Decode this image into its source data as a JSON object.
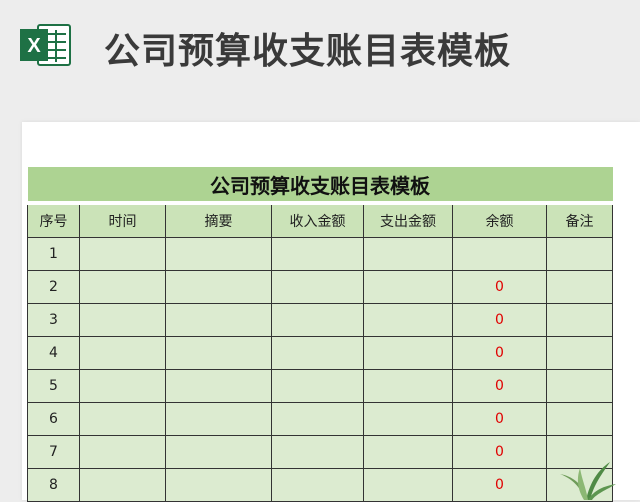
{
  "header": {
    "title": "公司预算收支账目表模板",
    "icon": "excel-icon",
    "icon_letter": "X"
  },
  "sheet": {
    "title": "公司预算收支账目表模板",
    "columns": [
      "序号",
      "时间",
      "摘要",
      "收入金额",
      "支出金额",
      "余额",
      "备注"
    ],
    "rows": [
      {
        "index": "1",
        "time": "",
        "summary": "",
        "income": "",
        "expense": "",
        "balance": "",
        "note": ""
      },
      {
        "index": "2",
        "time": "",
        "summary": "",
        "income": "",
        "expense": "",
        "balance": "0",
        "note": ""
      },
      {
        "index": "3",
        "time": "",
        "summary": "",
        "income": "",
        "expense": "",
        "balance": "0",
        "note": ""
      },
      {
        "index": "4",
        "time": "",
        "summary": "",
        "income": "",
        "expense": "",
        "balance": "0",
        "note": ""
      },
      {
        "index": "5",
        "time": "",
        "summary": "",
        "income": "",
        "expense": "",
        "balance": "0",
        "note": ""
      },
      {
        "index": "6",
        "time": "",
        "summary": "",
        "income": "",
        "expense": "",
        "balance": "0",
        "note": ""
      },
      {
        "index": "7",
        "time": "",
        "summary": "",
        "income": "",
        "expense": "",
        "balance": "0",
        "note": ""
      },
      {
        "index": "8",
        "time": "",
        "summary": "",
        "income": "",
        "expense": "",
        "balance": "0",
        "note": ""
      }
    ]
  },
  "colors": {
    "title_bar": "#add392",
    "header_row": "#cbe3b8",
    "body_row": "#dcebd0",
    "balance_text": "#e00000",
    "excel_green": "#1e7145"
  }
}
